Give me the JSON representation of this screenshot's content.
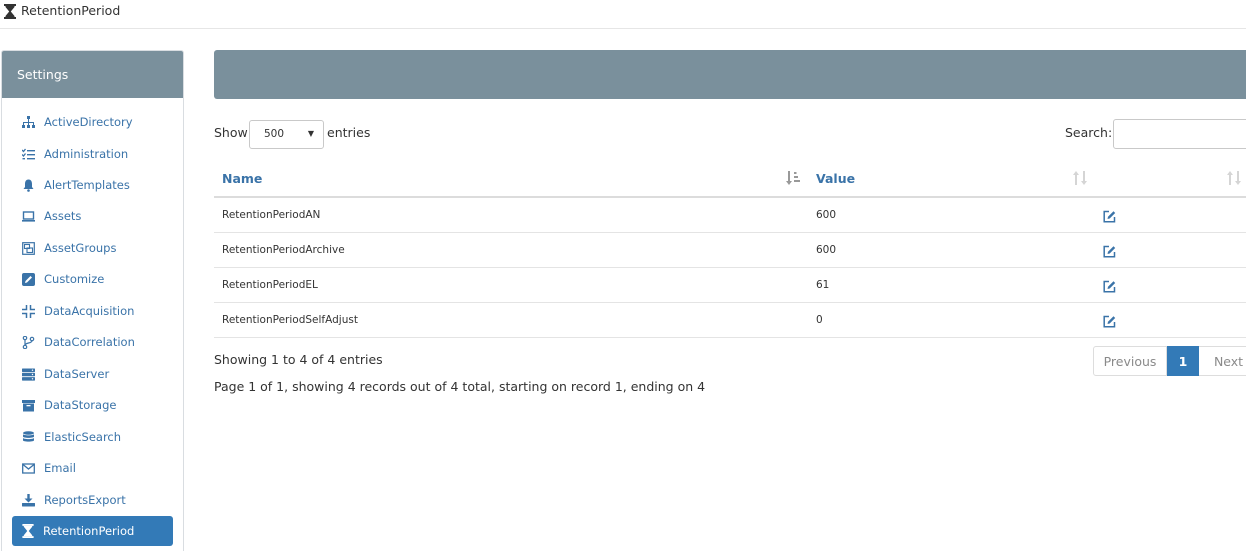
{
  "window": {
    "title": "RetentionPeriod",
    "icon": "hourglass-icon"
  },
  "sidebar": {
    "title": "Settings",
    "items": [
      {
        "label": "ActiveDirectory",
        "icon": "sitemap-icon"
      },
      {
        "label": "Administration",
        "icon": "tasks-list-icon"
      },
      {
        "label": "AlertTemplates",
        "icon": "bell-icon"
      },
      {
        "label": "Assets",
        "icon": "laptop-icon"
      },
      {
        "label": "AssetGroups",
        "icon": "object-group-icon"
      },
      {
        "label": "Customize",
        "icon": "edit-square-icon"
      },
      {
        "label": "DataAcquisition",
        "icon": "compress-icon"
      },
      {
        "label": "DataCorrelation",
        "icon": "code-branch-icon"
      },
      {
        "label": "DataServer",
        "icon": "server-icon"
      },
      {
        "label": "DataStorage",
        "icon": "archive-icon"
      },
      {
        "label": "ElasticSearch",
        "icon": "database-icon"
      },
      {
        "label": "Email",
        "icon": "envelope-icon"
      },
      {
        "label": "ReportsExport",
        "icon": "download-icon"
      },
      {
        "label": "RetentionPeriod",
        "icon": "hourglass-icon",
        "active": true
      }
    ]
  },
  "table_controls": {
    "show_label": "Show",
    "page_size": "500",
    "entries_label": "entries",
    "search_label": "Search:",
    "search_value": ""
  },
  "table": {
    "columns": [
      "Name",
      "Value",
      ""
    ],
    "rows": [
      {
        "name": "RetentionPeriodAN",
        "value": "600"
      },
      {
        "name": "RetentionPeriodArchive",
        "value": "600"
      },
      {
        "name": "RetentionPeriodEL",
        "value": "61"
      },
      {
        "name": "RetentionPeriodSelfAdjust",
        "value": "0"
      }
    ]
  },
  "footer": {
    "info": "Showing 1 to 4 of 4 entries",
    "page_info": "Page 1 of 1, showing 4 records out of 4 total, starting on record 1, ending on 4",
    "prev_label": "Previous",
    "current_page": "1",
    "next_label": "Next"
  },
  "colors": {
    "header_bg": "#7a909c",
    "accent": "#337ab7",
    "link": "#3a73a8"
  }
}
